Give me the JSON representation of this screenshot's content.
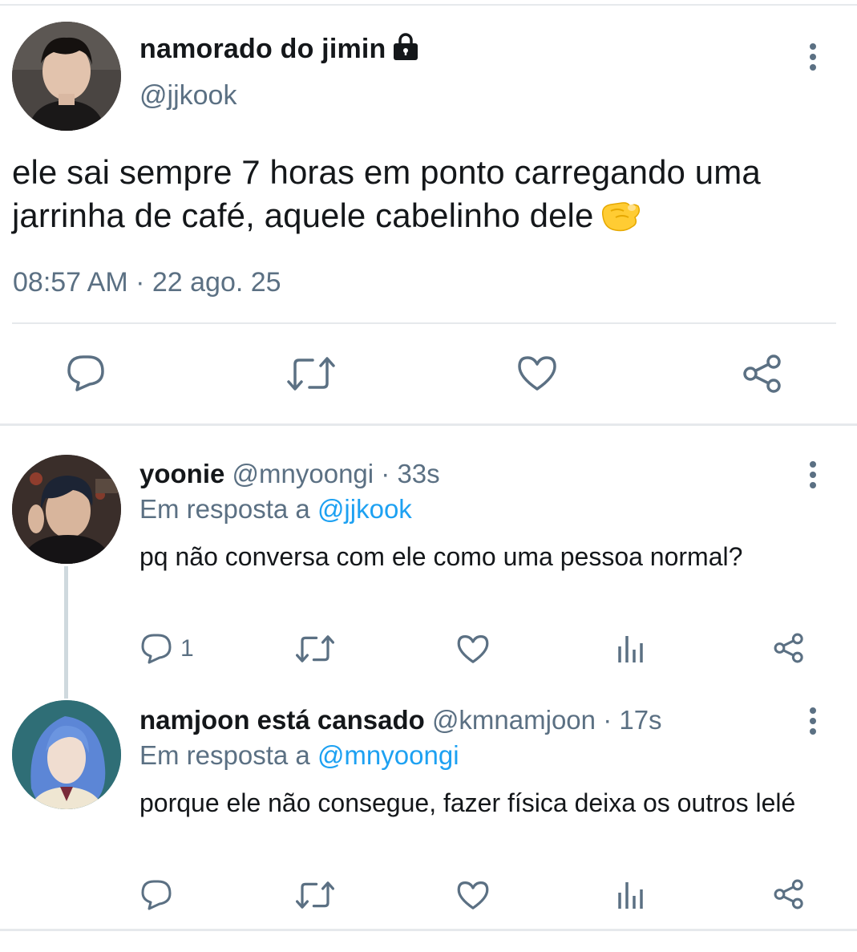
{
  "main_tweet": {
    "display_name": "namorado do jimin",
    "handle": "@jjkook",
    "text": "ele sai sempre 7 horas em ponto carregando uma jarrinha de café, aquele cabelinho dele",
    "emoji": "pinching-hand",
    "timestamp": "08:57 AM · 22 ago. 25",
    "icons": [
      "reply-icon",
      "retweet-icon",
      "like-icon",
      "share-icon"
    ]
  },
  "replies": [
    {
      "display_name": "yoonie",
      "handle": "@mnyoongi",
      "time": "· 33s",
      "reply_prefix": "Em resposta a",
      "reply_to": "@jjkook",
      "text": "pq não conversa com ele como uma pessoa normal?",
      "reply_count": "1"
    },
    {
      "display_name": "namjoon está cansado",
      "handle": "@kmnamjoon",
      "time": "· 17s",
      "reply_prefix": "Em resposta a",
      "reply_to": "@mnyoongi",
      "text": "porque ele não consegue, fazer física deixa os outros lelé",
      "reply_count": ""
    }
  ],
  "colors": {
    "text": "#14171a",
    "secondary": "#5b7083",
    "link": "#1da1f2",
    "divider": "#e6e9ec"
  }
}
